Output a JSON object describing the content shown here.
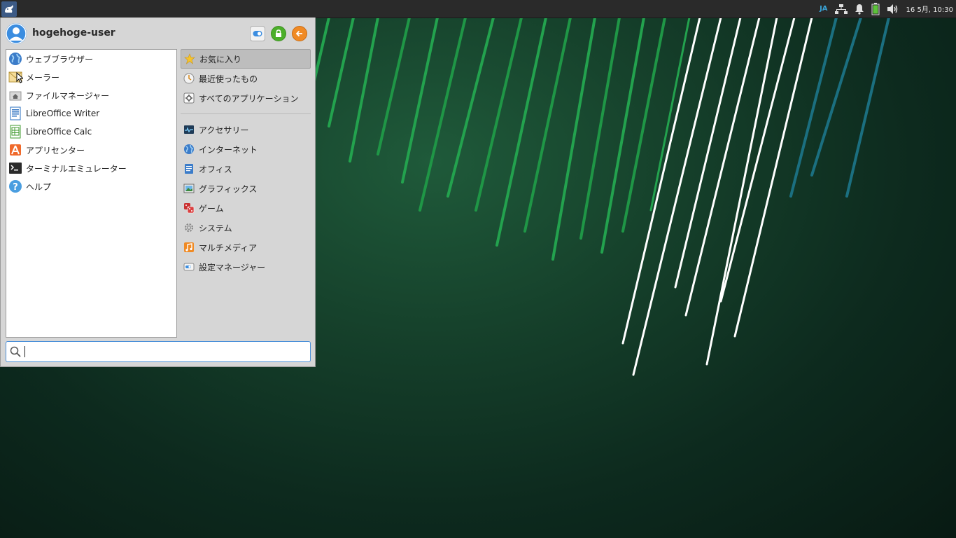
{
  "panel": {
    "input_method": "JA",
    "clock": "16 5月, 10:30",
    "icons": [
      "whisker-menu-icon",
      "network-icon",
      "notification-bell-icon",
      "battery-icon",
      "volume-icon"
    ]
  },
  "menu": {
    "username": "hogehoge-user",
    "header_buttons": [
      "settings-icon",
      "lock-icon",
      "logout-icon"
    ],
    "favorites": [
      {
        "label": "ウェブブラウザー",
        "icon": "globe-icon"
      },
      {
        "label": "メーラー",
        "icon": "mail-icon"
      },
      {
        "label": "ファイルマネージャー",
        "icon": "home-folder-icon"
      },
      {
        "label": "LibreOffice Writer",
        "icon": "writer-icon"
      },
      {
        "label": "LibreOffice Calc",
        "icon": "calc-icon"
      },
      {
        "label": "アプリセンター",
        "icon": "app-center-icon"
      },
      {
        "label": "ターミナルエミュレーター",
        "icon": "terminal-icon"
      },
      {
        "label": "ヘルプ",
        "icon": "help-icon"
      }
    ],
    "categories_top": [
      {
        "label": "お気に入り",
        "icon": "star-icon",
        "active": true
      },
      {
        "label": "最近使ったもの",
        "icon": "recent-icon"
      },
      {
        "label": "すべてのアプリケーション",
        "icon": "all-apps-icon"
      }
    ],
    "categories": [
      {
        "label": "アクセサリー",
        "icon": "accessories-icon"
      },
      {
        "label": "インターネット",
        "icon": "internet-icon"
      },
      {
        "label": "オフィス",
        "icon": "office-icon"
      },
      {
        "label": "グラフィックス",
        "icon": "graphics-icon"
      },
      {
        "label": "ゲーム",
        "icon": "games-icon"
      },
      {
        "label": "システム",
        "icon": "system-icon"
      },
      {
        "label": "マルチメディア",
        "icon": "multimedia-icon"
      },
      {
        "label": "設定マネージャー",
        "icon": "settings-manager-icon"
      }
    ],
    "search": {
      "value": "",
      "placeholder": ""
    }
  },
  "colors": {
    "accent": "#4a90d9",
    "panel_bg": "#2a2a2a",
    "menu_bg": "#d6d6d6",
    "wallpaper": "#153f2a",
    "lock_green": "#4caf2a",
    "logout_orange": "#f08a24"
  }
}
